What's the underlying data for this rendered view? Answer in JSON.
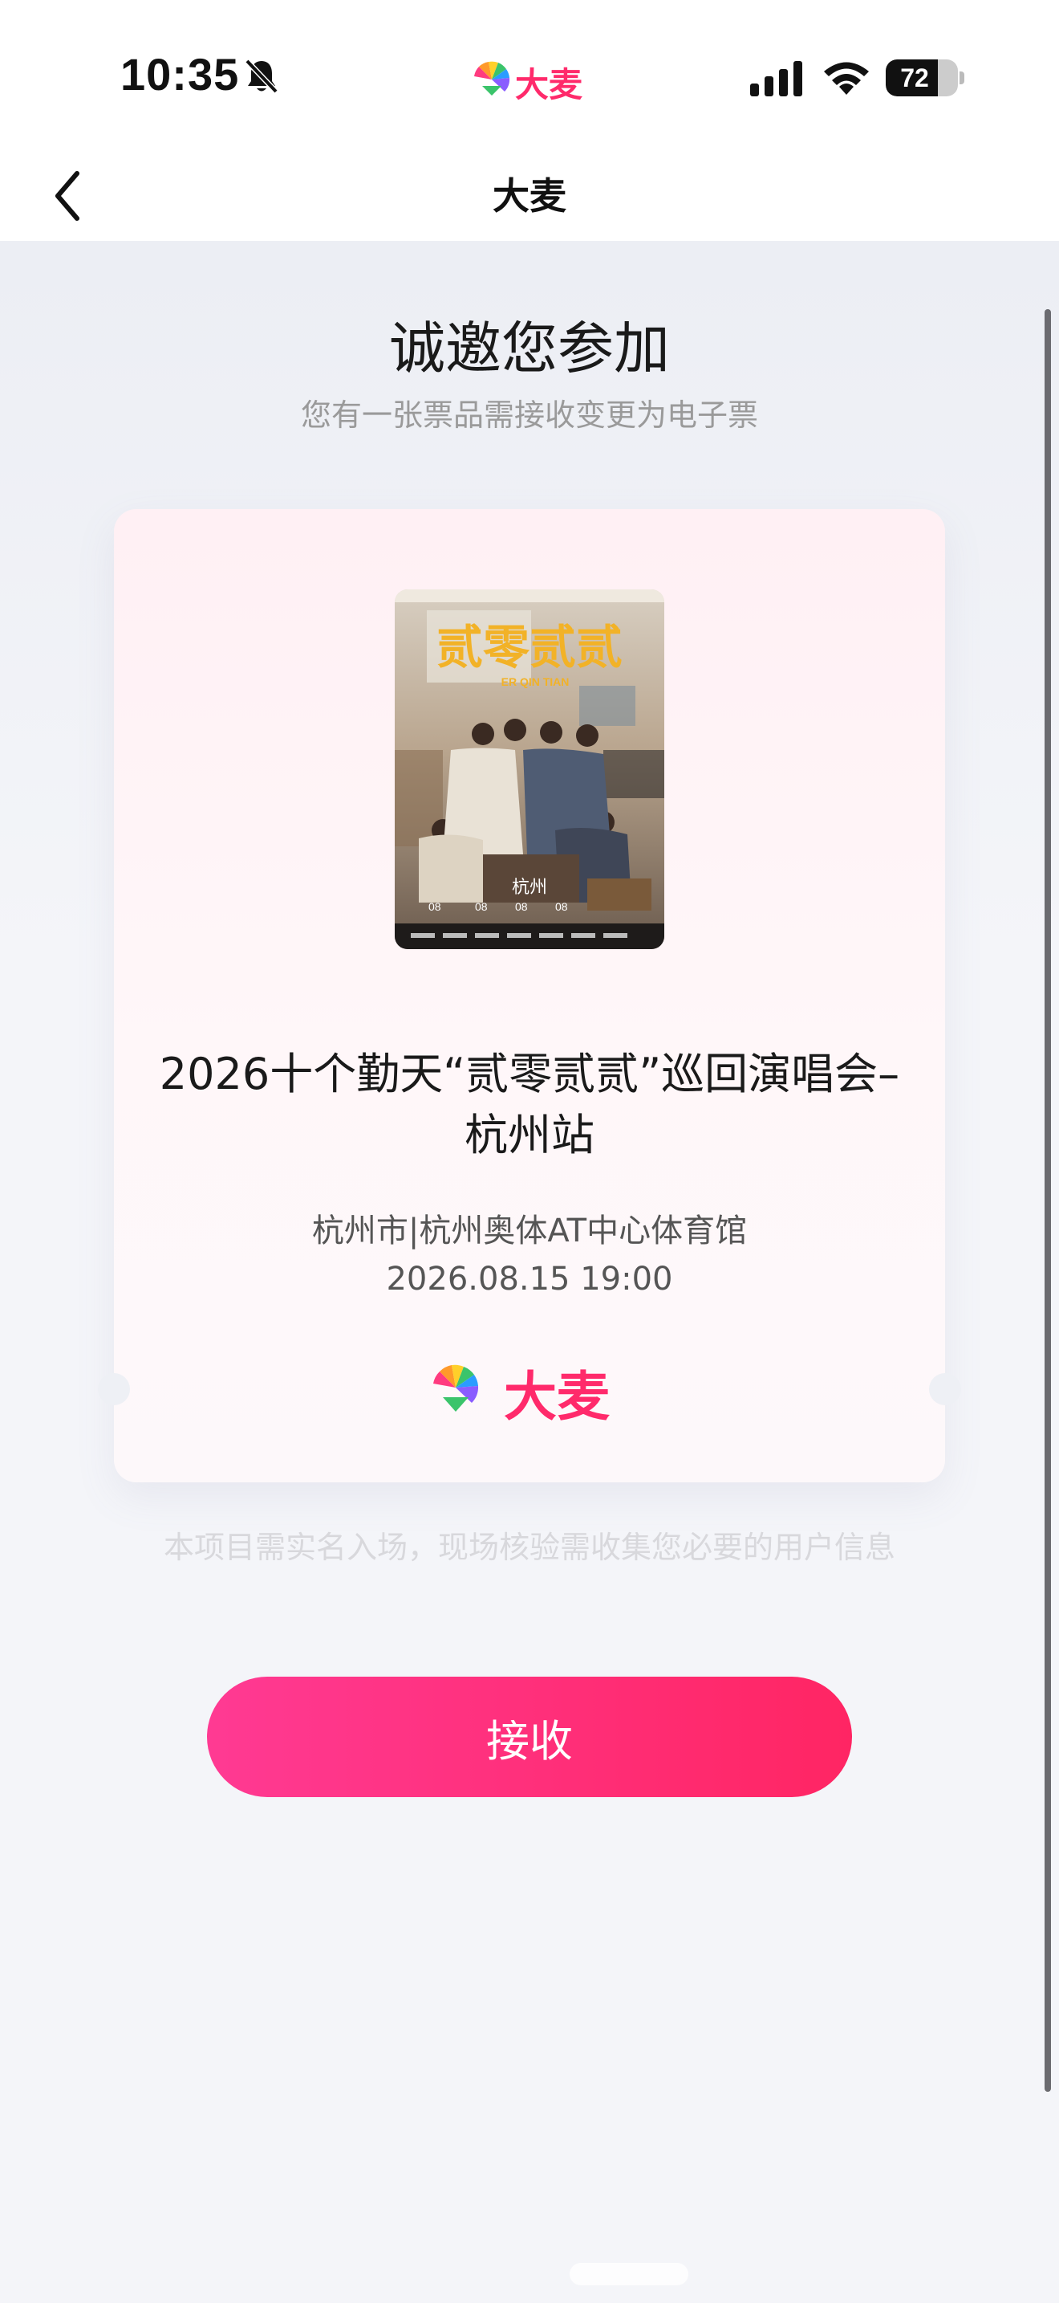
{
  "status": {
    "time": "10:35",
    "brand": "大麦",
    "battery_percent": "72",
    "battery_level": 0.72
  },
  "nav": {
    "title": "大麦"
  },
  "invite": {
    "title": "诚邀您参加",
    "subtitle": "您有一张票品需接收变更为电子票"
  },
  "ticket": {
    "poster_title": "贰零贰贰",
    "poster_subtitle": "ER QIN TIAN",
    "poster_city": "杭州",
    "poster_dates": [
      "08",
      "08",
      "08",
      "08"
    ],
    "title_line1": "2026十个勤天“贰零贰贰”巡回演唱会–",
    "title_line2": "杭州站",
    "venue": "杭州市|杭州奥体AT中心体育馆",
    "datetime": "2026.08.15 19:00",
    "brand": "大麦"
  },
  "notice": "本项目需实名入场，现场核验需收集您必要的用户信息",
  "accept_button": "接收",
  "colors": {
    "accent": "#ff2a6b",
    "button_start": "#ff3a93",
    "button_end": "#ff2563"
  },
  "icons": [
    "bell-slash-icon",
    "damai-logo-icon",
    "signal-icon",
    "wifi-icon",
    "battery-icon",
    "back-chevron-icon"
  ]
}
